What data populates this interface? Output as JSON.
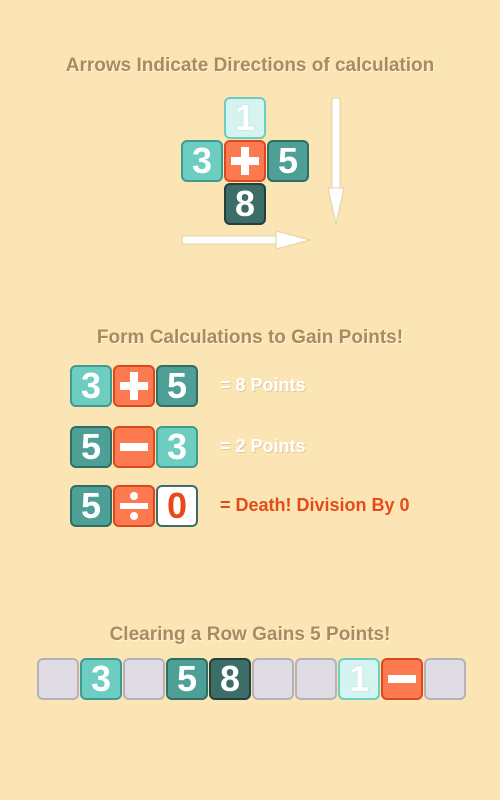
{
  "sections": {
    "directions_title": "Arrows Indicate Directions of calculation",
    "calculations_title": "Form Calculations to Gain Points!",
    "row_title": "Clearing a Row Gains 5 Points!"
  },
  "diagram": {
    "top": "1",
    "left": "3",
    "center_icon": "plus-icon",
    "right": "5",
    "bottom": "8"
  },
  "examples": [
    {
      "a": "3",
      "op_icon": "plus-icon",
      "b": "5",
      "result": "= 8 Points"
    },
    {
      "a": "5",
      "op_icon": "minus-icon",
      "b": "3",
      "result": "= 2 Points"
    },
    {
      "a": "5",
      "op_icon": "divide-icon",
      "b": "0",
      "result": "= Death! Division By 0"
    }
  ],
  "row": [
    "",
    "3",
    "",
    "5",
    "8",
    "",
    "",
    "1",
    "minus-icon",
    ""
  ],
  "colors": {
    "background": "#fbe5b5",
    "heading": "#ad8a5e",
    "operator_tile": "#fd7a50",
    "death_text": "#e64a19",
    "light_tile": "#6ccdc0",
    "dark_tile": "#3c6d69"
  }
}
